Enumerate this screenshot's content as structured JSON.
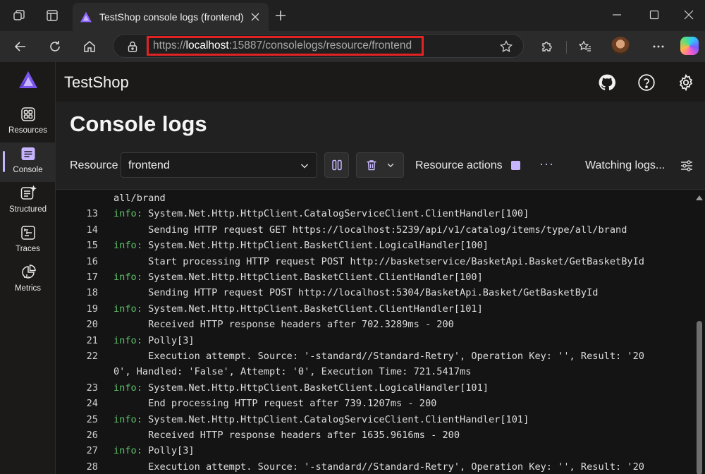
{
  "browser": {
    "tab_title": "TestShop console logs (frontend)",
    "url_scheme": "https://",
    "url_host": "localhost",
    "url_rest": ":15887/consolelogs/resource/frontend",
    "icons": [
      "workspaces-icon",
      "tab-actions-icon",
      "back-icon",
      "refresh-icon",
      "home-icon",
      "lock-icon",
      "favorite-star-icon",
      "extensions-icon",
      "favorites-icon",
      "more-icon"
    ]
  },
  "app": {
    "title": "TestShop",
    "sidebar": [
      {
        "label": "Resources",
        "icon": "resources-icon"
      },
      {
        "label": "Console",
        "icon": "console-icon"
      },
      {
        "label": "Structured",
        "icon": "structured-icon"
      },
      {
        "label": "Traces",
        "icon": "traces-icon"
      },
      {
        "label": "Metrics",
        "icon": "metrics-icon"
      }
    ],
    "active_nav": "Console"
  },
  "page": {
    "title": "Console logs",
    "resource_label": "Resource",
    "resource_value": "frontend",
    "resource_actions_label": "Resource actions",
    "more_label": "···",
    "status": "Watching logs..."
  },
  "logs": [
    {
      "n": "",
      "level": "",
      "text": "all/brand"
    },
    {
      "n": "13",
      "level": "info:",
      "text": " System.Net.Http.HttpClient.CatalogServiceClient.ClientHandler[100]"
    },
    {
      "n": "14",
      "level": "",
      "text": "      Sending HTTP request GET https://localhost:5239/api/v1/catalog/items/type/all/brand"
    },
    {
      "n": "15",
      "level": "info:",
      "text": " System.Net.Http.HttpClient.BasketClient.LogicalHandler[100]"
    },
    {
      "n": "16",
      "level": "",
      "text": "      Start processing HTTP request POST http://basketservice/BasketApi.Basket/GetBasketById"
    },
    {
      "n": "17",
      "level": "info:",
      "text": " System.Net.Http.HttpClient.BasketClient.ClientHandler[100]"
    },
    {
      "n": "18",
      "level": "",
      "text": "      Sending HTTP request POST http://localhost:5304/BasketApi.Basket/GetBasketById"
    },
    {
      "n": "19",
      "level": "info:",
      "text": " System.Net.Http.HttpClient.BasketClient.ClientHandler[101]"
    },
    {
      "n": "20",
      "level": "",
      "text": "      Received HTTP response headers after 702.3289ms - 200"
    },
    {
      "n": "21",
      "level": "info:",
      "text": " Polly[3]"
    },
    {
      "n": "22",
      "level": "",
      "text": "      Execution attempt. Source: '-standard//Standard-Retry', Operation Key: '', Result: '20"
    },
    {
      "n": "",
      "level": "",
      "text": "0', Handled: 'False', Attempt: '0', Execution Time: 721.5417ms"
    },
    {
      "n": "23",
      "level": "info:",
      "text": " System.Net.Http.HttpClient.BasketClient.LogicalHandler[101]"
    },
    {
      "n": "24",
      "level": "",
      "text": "      End processing HTTP request after 739.1207ms - 200"
    },
    {
      "n": "25",
      "level": "info:",
      "text": " System.Net.Http.HttpClient.CatalogServiceClient.ClientHandler[101]"
    },
    {
      "n": "26",
      "level": "",
      "text": "      Received HTTP response headers after 1635.9616ms - 200"
    },
    {
      "n": "27",
      "level": "info:",
      "text": " Polly[3]"
    },
    {
      "n": "28",
      "level": "",
      "text": "      Execution attempt. Source: '-standard//Standard-Retry', Operation Key: '', Result: '20"
    }
  ]
}
